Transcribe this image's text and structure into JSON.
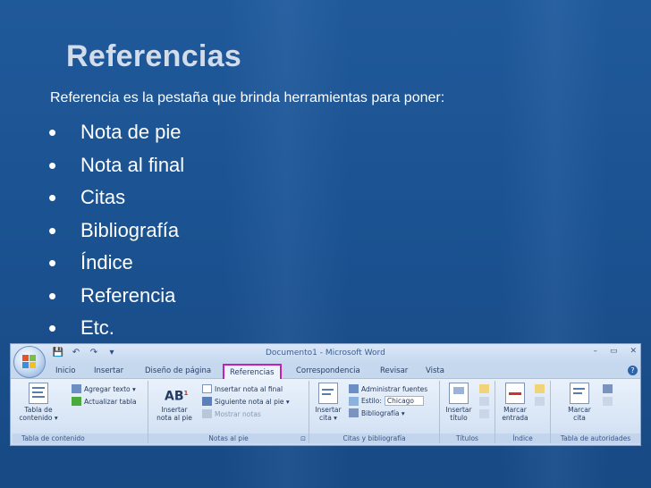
{
  "slide": {
    "title": "Referencias",
    "intro": "Referencia es la pestaña que brinda herramientas para poner:",
    "bullets": [
      "Nota de pie",
      "Nota al final",
      "Citas",
      "Bibliografía",
      "Índice",
      "Referencia",
      "Etc."
    ],
    "bullet_glyph": "•"
  },
  "word": {
    "window_title": "Documento1 - Microsoft Word",
    "qat": {
      "save_glyph": "💾",
      "undo_glyph": "↶",
      "redo_glyph": "↷",
      "more_glyph": "▾"
    },
    "window_buttons": {
      "minimize": "–",
      "restore": "▭",
      "close": "✕"
    },
    "help_glyph": "?",
    "tabs": [
      "Inicio",
      "Insertar",
      "Diseño de página",
      "Referencias",
      "Correspondencia",
      "Revisar",
      "Vista"
    ],
    "active_tab": "Referencias",
    "groups": {
      "tabla_contenido": {
        "caption": "Tabla de contenido",
        "big_label_1": "Tabla de",
        "big_label_2": "contenido ▾",
        "agregar_texto": "Agregar texto ▾",
        "actualizar_tabla": "Actualizar tabla"
      },
      "notas_pie": {
        "caption": "Notas al pie",
        "insertar_nota_1": "Insertar",
        "insertar_nota_2": "nota al pie",
        "ab_glyph": "AB",
        "ab_superscript": "1",
        "nota_final": "Insertar nota al final",
        "siguiente_nota": "Siguiente nota al pie ▾",
        "mostrar_notas": "Mostrar notas",
        "launcher": "⊡"
      },
      "citas": {
        "caption": "Citas y bibliografía",
        "insertar_cita_1": "Insertar",
        "insertar_cita_2": "cita ▾",
        "administrar_fuentes": "Administrar fuentes",
        "estilo_label": "Estilo:",
        "estilo_value": "Chicago",
        "bibliografia": "Bibliografía ▾"
      },
      "titulos": {
        "caption": "Títulos",
        "insertar_titulo_1": "Insertar",
        "insertar_titulo_2": "título"
      },
      "indice": {
        "caption": "Índice",
        "marcar_entrada_1": "Marcar",
        "marcar_entrada_2": "entrada"
      },
      "autoridades": {
        "caption": "Tabla de autoridades",
        "marcar_cita_1": "Marcar",
        "marcar_cita_2": "cita"
      }
    }
  },
  "colors": {
    "background": "#1b5291",
    "title": "#d3dceb",
    "text": "#ffffff",
    "highlight": "#c61fb8"
  }
}
